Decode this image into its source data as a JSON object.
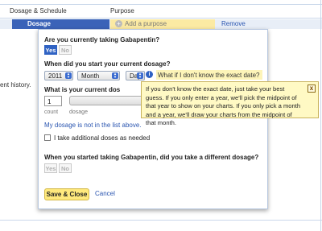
{
  "header": {
    "col1": "Dosage & Schedule",
    "col2": "Purpose"
  },
  "row": {
    "tab_label": "Dosage",
    "add_purpose": "Add a purpose",
    "remove": "Remove"
  },
  "background_text": "ent history.",
  "modal": {
    "q_taking": "Are you currently taking Gabapentin?",
    "yes": "Yes",
    "no": "No",
    "taking_selected": "Yes",
    "q_start": "When did you start your current dosage?",
    "year": "2011",
    "month": "Month",
    "day": "Day",
    "exact_date_link": "What if I don't know the exact date?",
    "q_dose": "What is your current dosage?",
    "q_dose_visible": "What is your current dos",
    "count_value": "1",
    "count_label": "count",
    "dosage_label": "dosage",
    "not_in_list": "My dosage is not in the list above.",
    "additional_doses": "I take additional doses as needed",
    "q_different": "When you started taking Gabapentin, did you take a different dosage?",
    "yes2": "Yes",
    "no2": "No",
    "save": "Save & Close",
    "cancel": "Cancel"
  },
  "tooltip": {
    "text": "If you don't know the exact date, just take your best guess. If you only enter a year, we'll pick the midpoint of that year to show on your charts. If you only pick a month and a year, we'll draw your charts from the midpoint of that month.",
    "close": "x"
  },
  "colors": {
    "accent": "#2f62c3",
    "tab": "#3b63b8",
    "highlight": "#fbeaa3",
    "tooltip_bg": "#fff9c4",
    "save_button": "#ffe97d"
  }
}
